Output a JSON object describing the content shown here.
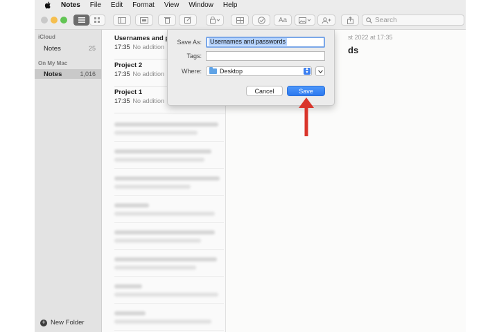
{
  "menubar": {
    "app": "Notes",
    "items": [
      "File",
      "Edit",
      "Format",
      "View",
      "Window",
      "Help"
    ]
  },
  "toolbar": {
    "search_placeholder": "Search",
    "text_style_label": "Aa"
  },
  "sidebar": {
    "sections": [
      {
        "heading": "iCloud",
        "items": [
          {
            "label": "Notes",
            "count": "25"
          }
        ]
      },
      {
        "heading": "On My Mac",
        "items": [
          {
            "label": "Notes",
            "count": "1,016"
          }
        ]
      }
    ],
    "new_folder": "New Folder"
  },
  "notes": [
    {
      "title": "Usernames and p",
      "time": "17:35",
      "sub": "No addition"
    },
    {
      "title": "Project 2",
      "time": "17:35",
      "sub": "No addition"
    },
    {
      "title": "Project 1",
      "time": "17:35",
      "sub": "No addition"
    }
  ],
  "editor": {
    "date_fragment": "st 2022 at 17:35",
    "title_fragment": "ds"
  },
  "dialog": {
    "save_as_label": "Save As:",
    "save_as_value": "Usernames and passwords",
    "tags_label": "Tags:",
    "where_label": "Where:",
    "where_value": "Desktop",
    "cancel_label": "Cancel",
    "save_label": "Save"
  },
  "colors": {
    "accent": "#2b78ef",
    "annotation_arrow": "#d9352b"
  }
}
